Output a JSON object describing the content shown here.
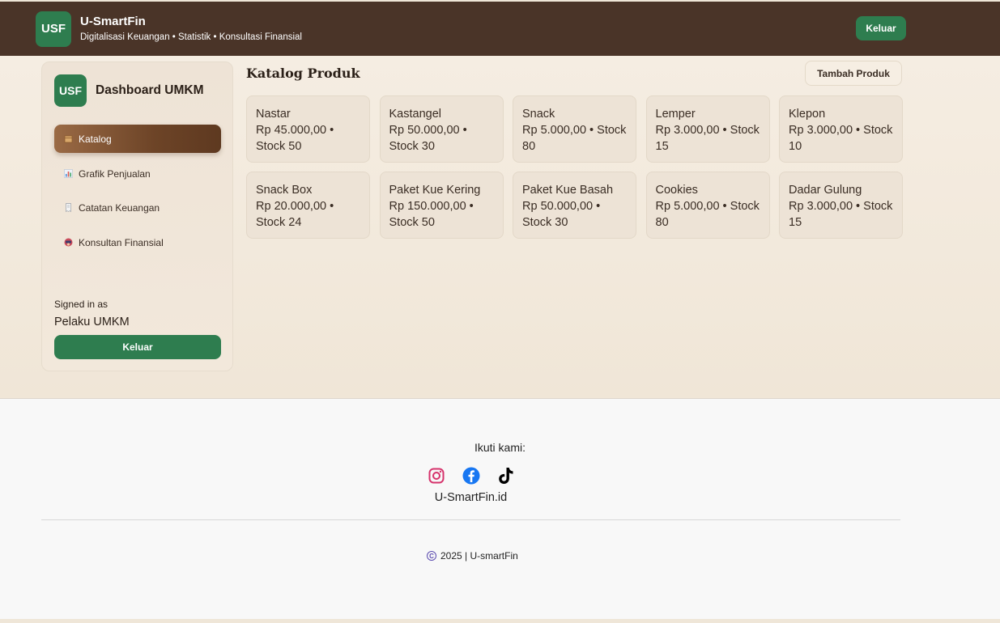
{
  "header": {
    "logo_text": "USF",
    "title": "U-SmartFin",
    "subtitle": "Digitalisasi Keuangan • Statistik • Konsultasi Finansial",
    "logout_label": "Keluar"
  },
  "sidebar": {
    "logo_text": "USF",
    "title": "Dashboard UMKM",
    "items": [
      {
        "label": "Katalog",
        "icon": "box-icon",
        "active": true
      },
      {
        "label": "Grafik Penjualan",
        "icon": "bar-chart-icon",
        "active": false
      },
      {
        "label": "Catatan Keuangan",
        "icon": "receipt-icon",
        "active": false
      },
      {
        "label": "Konsultan Finansial",
        "icon": "consultant-icon",
        "active": false
      }
    ],
    "signed_in_label": "Signed in as",
    "signed_in_name": "Pelaku UMKM",
    "logout_label": "Keluar"
  },
  "content": {
    "title": "Katalog Produk",
    "add_button": "Tambah Produk",
    "products": [
      {
        "name": "Nastar",
        "price": "Rp 45.000,00",
        "stock": "Stock 50"
      },
      {
        "name": "Kastangel",
        "price": "Rp 50.000,00",
        "stock": "Stock 30"
      },
      {
        "name": "Snack",
        "price": "Rp 5.000,00",
        "stock": "Stock 80"
      },
      {
        "name": "Lemper",
        "price": "Rp 3.000,00",
        "stock": "Stock 15"
      },
      {
        "name": "Klepon",
        "price": "Rp 3.000,00",
        "stock": "Stock 10"
      },
      {
        "name": "Snack Box",
        "price": "Rp 20.000,00",
        "stock": "Stock 24"
      },
      {
        "name": "Paket Kue Kering",
        "price": "Rp 150.000,00",
        "stock": "Stock 50"
      },
      {
        "name": "Paket Kue Basah",
        "price": "Rp 50.000,00",
        "stock": "Stock 30"
      },
      {
        "name": "Cookies",
        "price": "Rp 5.000,00",
        "stock": "Stock 80"
      },
      {
        "name": "Dadar Gulung",
        "price": "Rp 3.000,00",
        "stock": "Stock 15"
      }
    ]
  },
  "footer": {
    "follow_label": "Ikuti kami:",
    "socials": [
      "instagram-icon",
      "facebook-icon",
      "tiktok-icon"
    ],
    "site": "U-SmartFin.id",
    "copyright": "2025 | U-smartFin"
  },
  "colors": {
    "header_bg": "#4a3428",
    "accent_green": "#2e7d4f",
    "active_nav": "#6d4427"
  }
}
